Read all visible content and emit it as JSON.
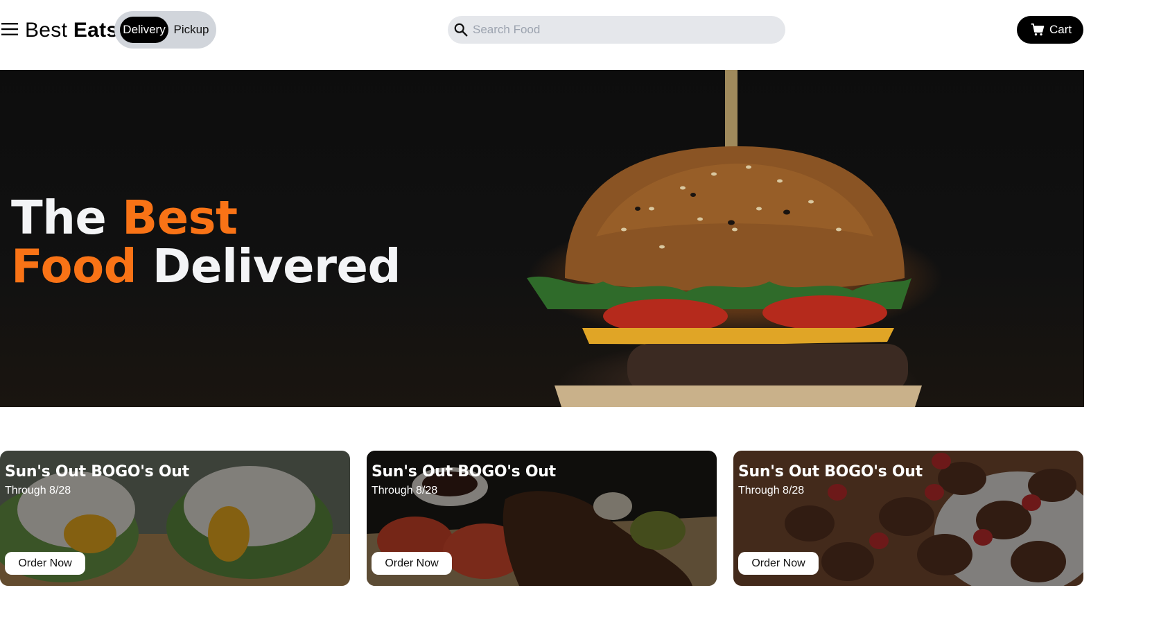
{
  "header": {
    "brand_light": "Best",
    "brand_bold": "Eats",
    "mode_toggle": {
      "delivery": "Delivery",
      "pickup": "Pickup",
      "selected": "Delivery"
    },
    "search": {
      "placeholder": "Search Food",
      "value": ""
    },
    "cart_label": "Cart"
  },
  "hero": {
    "line1_white": "The",
    "line1_accent": "Best",
    "line2_accent": "Food",
    "line2_white": "Delivered",
    "accent_color": "#f97316"
  },
  "promos": [
    {
      "title": "Sun's Out BOGO's Out",
      "subtitle": "Through 8/28",
      "button": "Order Now"
    },
    {
      "title": "Sun's Out BOGO's Out",
      "subtitle": "Through 8/28",
      "button": "Order Now"
    },
    {
      "title": "Sun's Out BOGO's Out",
      "subtitle": "Through 8/28",
      "button": "Order Now"
    }
  ],
  "icons": {
    "menu": "menu-icon",
    "search": "search-icon",
    "cart": "cart-icon"
  }
}
